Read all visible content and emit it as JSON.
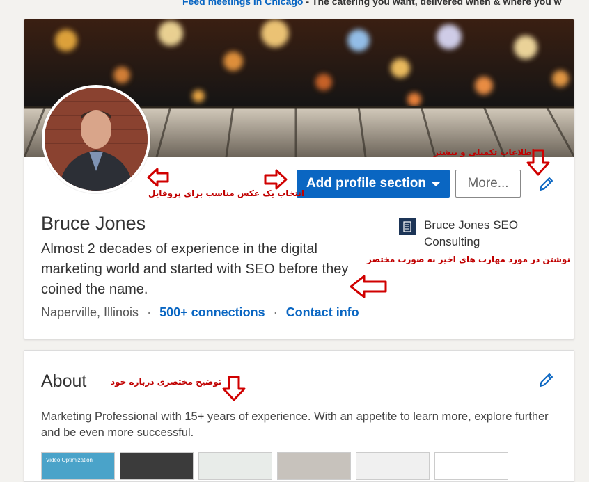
{
  "ad": {
    "link_text": "Feed meetings in Chicago",
    "separator": " - ",
    "text": "The catering you want, delivered when & where you w"
  },
  "profile": {
    "name": "Bruce Jones",
    "headline": "Almost 2 decades of experience in the digital marketing world and started with SEO before they coined the name.",
    "location": "Naperville, Illinois",
    "connections": "500+ connections",
    "contact": "Contact info",
    "separator": "·",
    "company": "Bruce Jones SEO Consulting",
    "add_section_label": "Add profile section",
    "more_label": "More..."
  },
  "about": {
    "title": "About",
    "text": "Marketing Professional with 15+ years of experience. With an appetite to learn more, explore further and be even more successful.",
    "thumbnails": [
      "Video Optimization",
      "",
      "",
      "",
      "",
      "",
      ""
    ]
  },
  "annotations": {
    "more_info": "اطلاعات تکمیلی و بیشتر",
    "photo": "انتخاب یک عکس مناسب برای پروفایل",
    "headline": "نوشتن در مورد مهارت های اخیر به صورت مختصر",
    "about": "توضیح مختصری درباره خود"
  },
  "colors": {
    "accent": "#0a66c2",
    "annotation": "#c00000",
    "background": "#f3f2ef"
  },
  "icons": [
    "pencil-icon",
    "caret-down-icon",
    "company-logo",
    "red-arrow-icon"
  ]
}
